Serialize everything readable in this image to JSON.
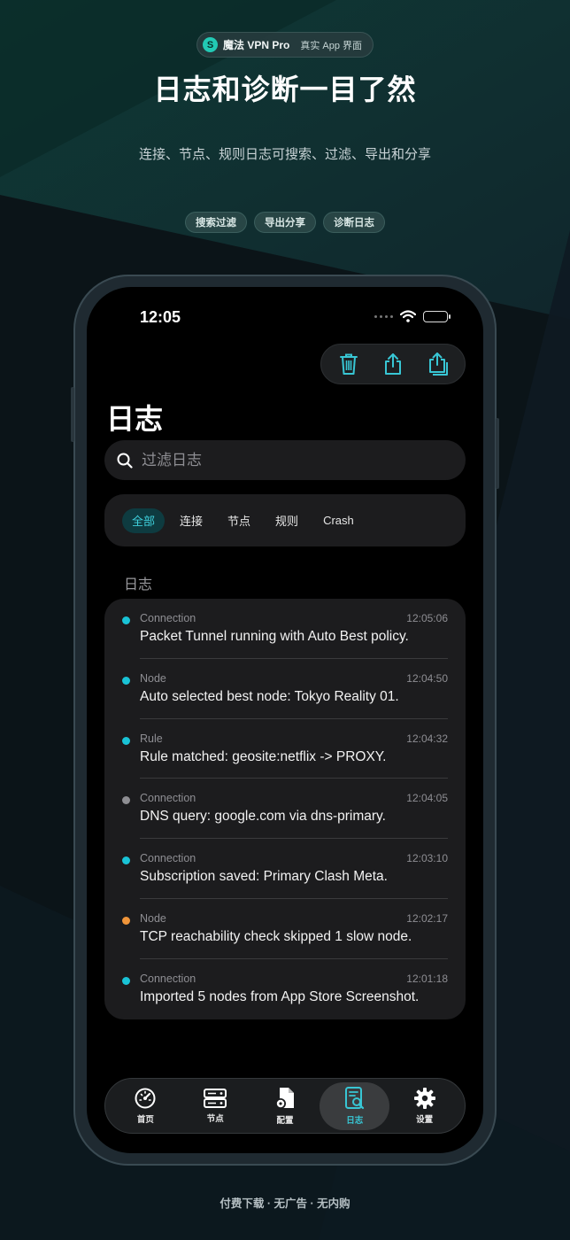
{
  "promo": {
    "app_name": "魔法 VPN Pro",
    "badge_text": "真实 App 界面",
    "headline": "日志和诊断一目了然",
    "subline": "连接、节点、规则日志可搜索、过滤、导出和分享",
    "chips": [
      "搜索过滤",
      "导出分享",
      "诊断日志"
    ],
    "footer": "付费下载 · 无广告 · 无内购"
  },
  "status": {
    "time": "12:05"
  },
  "screen": {
    "title": "日志",
    "search": {
      "placeholder": "过滤日志",
      "value": ""
    },
    "filters": [
      {
        "label": "全部",
        "active": true
      },
      {
        "label": "连接",
        "active": false
      },
      {
        "label": "节点",
        "active": false
      },
      {
        "label": "规则",
        "active": false
      },
      {
        "label": "Crash",
        "active": false
      }
    ],
    "section_label": "日志",
    "logs": [
      {
        "category": "Connection",
        "time": "12:05:06",
        "message": "Packet Tunnel running with Auto Best policy.",
        "color": "#19c3d6"
      },
      {
        "category": "Node",
        "time": "12:04:50",
        "message": "Auto selected best node: Tokyo Reality 01.",
        "color": "#19c3d6"
      },
      {
        "category": "Rule",
        "time": "12:04:32",
        "message": "Rule matched: geosite:netflix -> PROXY.",
        "color": "#19c3d6"
      },
      {
        "category": "Connection",
        "time": "12:04:05",
        "message": "DNS query: google.com via dns-primary.",
        "color": "#8e8e93"
      },
      {
        "category": "Connection",
        "time": "12:03:10",
        "message": "Subscription saved: Primary Clash Meta.",
        "color": "#19c3d6"
      },
      {
        "category": "Node",
        "time": "12:02:17",
        "message": "TCP reachability check skipped 1 slow node.",
        "color": "#f0953a"
      },
      {
        "category": "Connection",
        "time": "12:01:18",
        "message": "Imported 5 nodes from App Store Screenshot.",
        "color": "#19c3d6"
      }
    ],
    "tabs": [
      {
        "label": "首页",
        "icon": "gauge-icon",
        "active": false
      },
      {
        "label": "节点",
        "icon": "server-icon",
        "active": false
      },
      {
        "label": "配置",
        "icon": "config-file-icon",
        "active": false
      },
      {
        "label": "日志",
        "icon": "log-search-icon",
        "active": true
      },
      {
        "label": "设置",
        "icon": "gear-icon",
        "active": false
      }
    ],
    "accent_color": "#38c6d4"
  }
}
